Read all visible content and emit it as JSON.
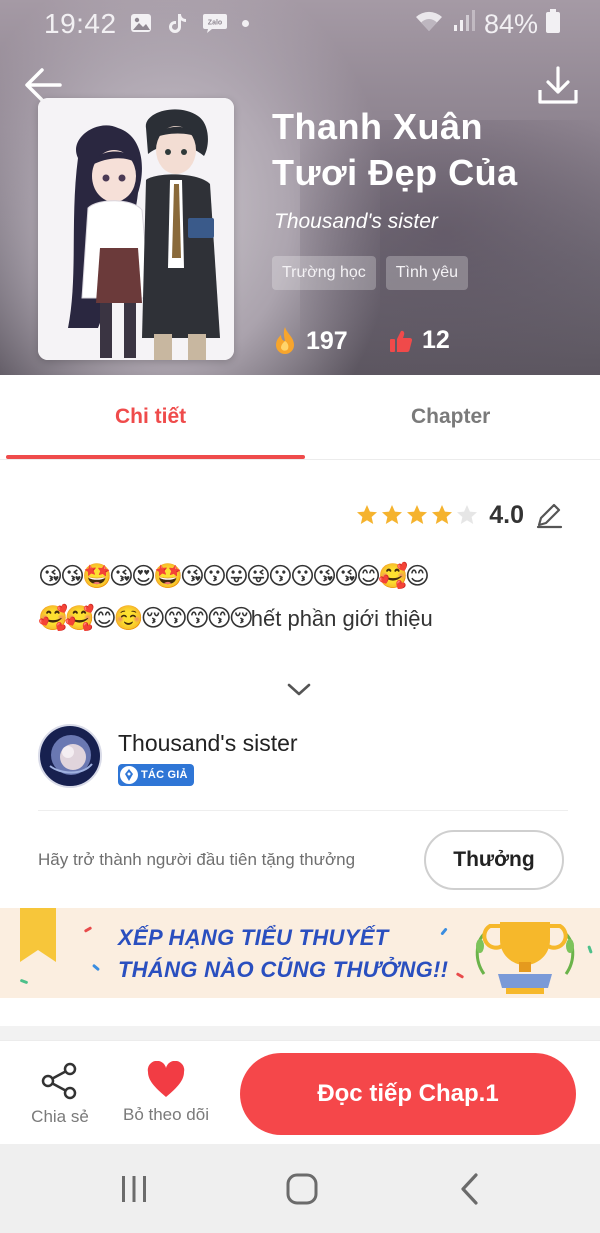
{
  "status_bar": {
    "time": "19:42",
    "notification_icons": [
      "image-icon",
      "tiktok-icon",
      "zalo-icon",
      "dot-icon"
    ],
    "zalo_label": "Zalo",
    "battery": "84%"
  },
  "header": {
    "back_icon": "back-arrow-icon",
    "download_icon": "download-icon",
    "title": "Thanh Xuân Tươi Đẹp Của",
    "author": "Thousand's sister",
    "tags": [
      "Trường học",
      "Tình yêu"
    ],
    "fire_count": "197",
    "like_count": "12"
  },
  "tabs": [
    {
      "label": "Chi tiết",
      "active": true
    },
    {
      "label": "Chapter",
      "active": false
    }
  ],
  "rating": {
    "value": "4.0",
    "stars_filled": 4,
    "stars_total": 5,
    "edit_icon": "pencil-icon"
  },
  "description": {
    "emojis_line1": "😘😘🤩😘😍🤩😘😗😛😜😗😗😘😘😊🥰😊",
    "emojis_line2": "🥰🥰😊☺️😚😙😙😙😚",
    "text": "hết phần giới thiệu"
  },
  "author_card": {
    "name": "Thousand's sister",
    "badge": "TÁC GIẢ"
  },
  "gift": {
    "prompt": "Hãy trở thành người đầu tiên tặng thưởng",
    "button": "Thưởng"
  },
  "banner": {
    "line1": "XẾP HẠNG TIỂU THUYẾT",
    "line2": "THÁNG NÀO CŨNG THƯỞNG!!"
  },
  "action_bar": {
    "share_label": "Chia sẻ",
    "follow_label": "Bỏ theo dõi",
    "read_button": "Đọc tiếp Chap.1"
  },
  "colors": {
    "accent": "#ef4b4b",
    "read_button": "#f5474a",
    "badge_blue": "#2f76d6",
    "banner_text": "#2a4fbf",
    "star": "#f5b32e"
  }
}
